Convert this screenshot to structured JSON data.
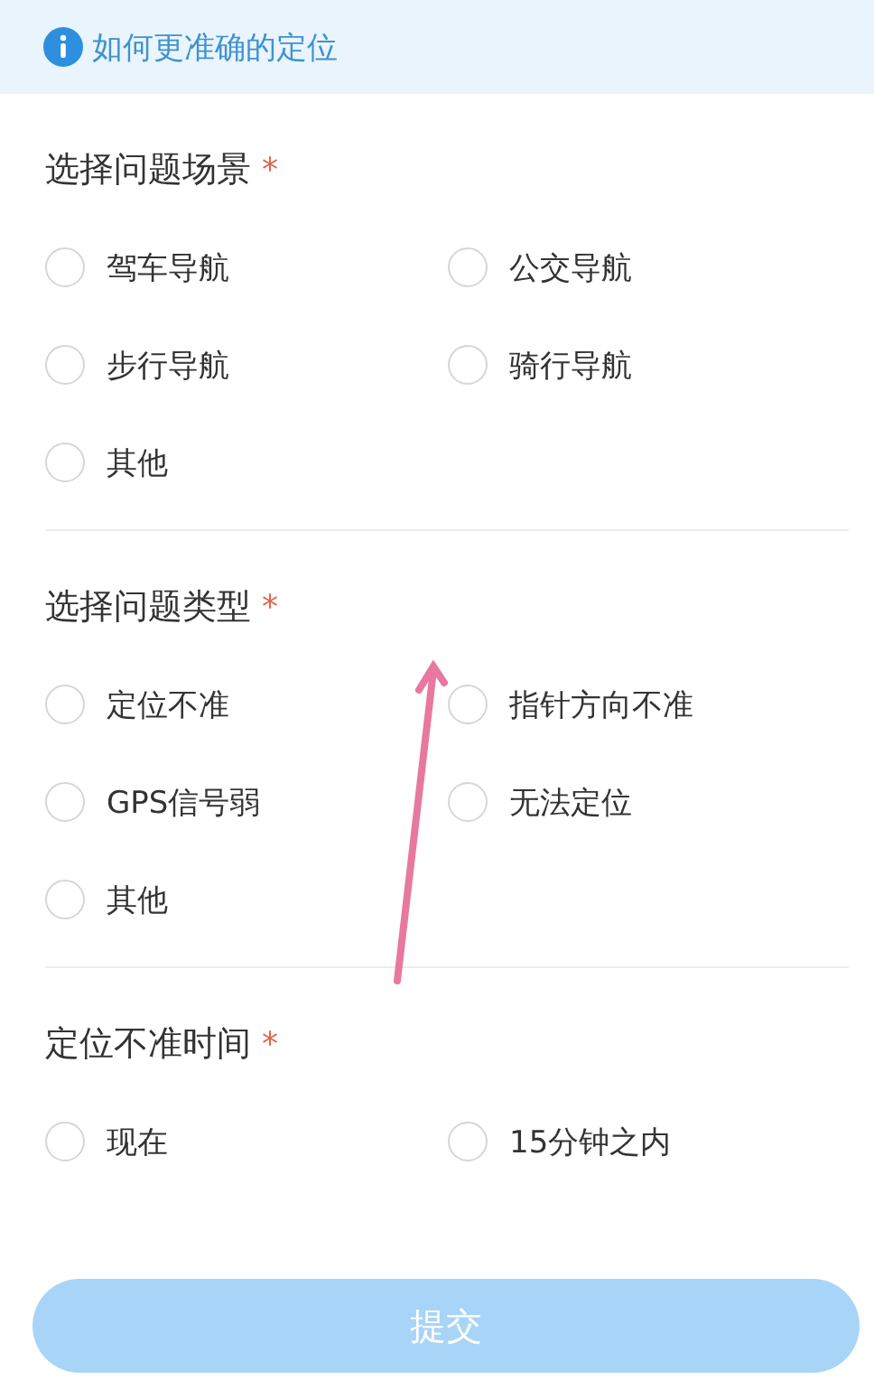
{
  "notice": {
    "title": "如何更准确的定位"
  },
  "sections": [
    {
      "title": "选择问题场景",
      "required_mark": "*",
      "options": [
        {
          "label": "驾车导航",
          "selected": false
        },
        {
          "label": "公交导航",
          "selected": false
        },
        {
          "label": "步行导航",
          "selected": false
        },
        {
          "label": "骑行导航",
          "selected": false
        },
        {
          "label": "其他",
          "selected": false
        }
      ]
    },
    {
      "title": "选择问题类型",
      "required_mark": "*",
      "options": [
        {
          "label": "定位不准",
          "selected": false
        },
        {
          "label": "指针方向不准",
          "selected": false
        },
        {
          "label": "GPS信号弱",
          "selected": false
        },
        {
          "label": "无法定位",
          "selected": false
        },
        {
          "label": "其他",
          "selected": false
        }
      ]
    },
    {
      "title": "定位不准时间",
      "required_mark": "*",
      "options": [
        {
          "label": "现在",
          "selected": false
        },
        {
          "label": "15分钟之内",
          "selected": false
        }
      ]
    }
  ],
  "submit_button": {
    "label": "提交",
    "disabled": true
  }
}
